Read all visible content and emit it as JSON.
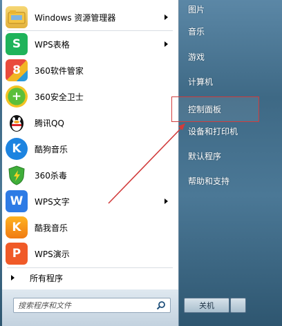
{
  "programs": [
    {
      "label": "Windows 资源管理器",
      "icon": "folder-icon",
      "has_submenu": true
    },
    {
      "label": "WPS表格",
      "icon": "wps-spreadsheet-icon",
      "icon_text": "S",
      "has_submenu": true
    },
    {
      "label": "360软件管家",
      "icon": "360-software-manager-icon",
      "icon_text": "8",
      "has_submenu": false
    },
    {
      "label": "360安全卫士",
      "icon": "360-security-guard-icon",
      "icon_text": "+",
      "has_submenu": false
    },
    {
      "label": "腾讯QQ",
      "icon": "qq-penguin-icon",
      "has_submenu": false
    },
    {
      "label": "酷狗音乐",
      "icon": "kugou-music-icon",
      "icon_text": "K",
      "has_submenu": false
    },
    {
      "label": "360杀毒",
      "icon": "360-antivirus-icon",
      "has_submenu": false
    },
    {
      "label": "WPS文字",
      "icon": "wps-writer-icon",
      "icon_text": "W",
      "has_submenu": true
    },
    {
      "label": "酷我音乐",
      "icon": "kuwo-music-icon",
      "icon_text": "K",
      "has_submenu": false
    },
    {
      "label": "WPS演示",
      "icon": "wps-presentation-icon",
      "icon_text": "P",
      "has_submenu": false
    }
  ],
  "all_programs_label": "所有程序",
  "search": {
    "placeholder": "搜索程序和文件"
  },
  "right_items": [
    "图片",
    "音乐",
    "游戏",
    "计算机",
    "控制面板",
    "设备和打印机",
    "默认程序",
    "帮助和支持"
  ],
  "shutdown": {
    "label": "关机"
  },
  "colors": {
    "highlight_border": "#d13b3b",
    "arrow": "#d13b3b",
    "wps_spreadsheet": "#1fb35a",
    "wps_writer": "#2d7be5",
    "wps_presentation": "#f05a28",
    "kugou": "#1d84e0"
  }
}
